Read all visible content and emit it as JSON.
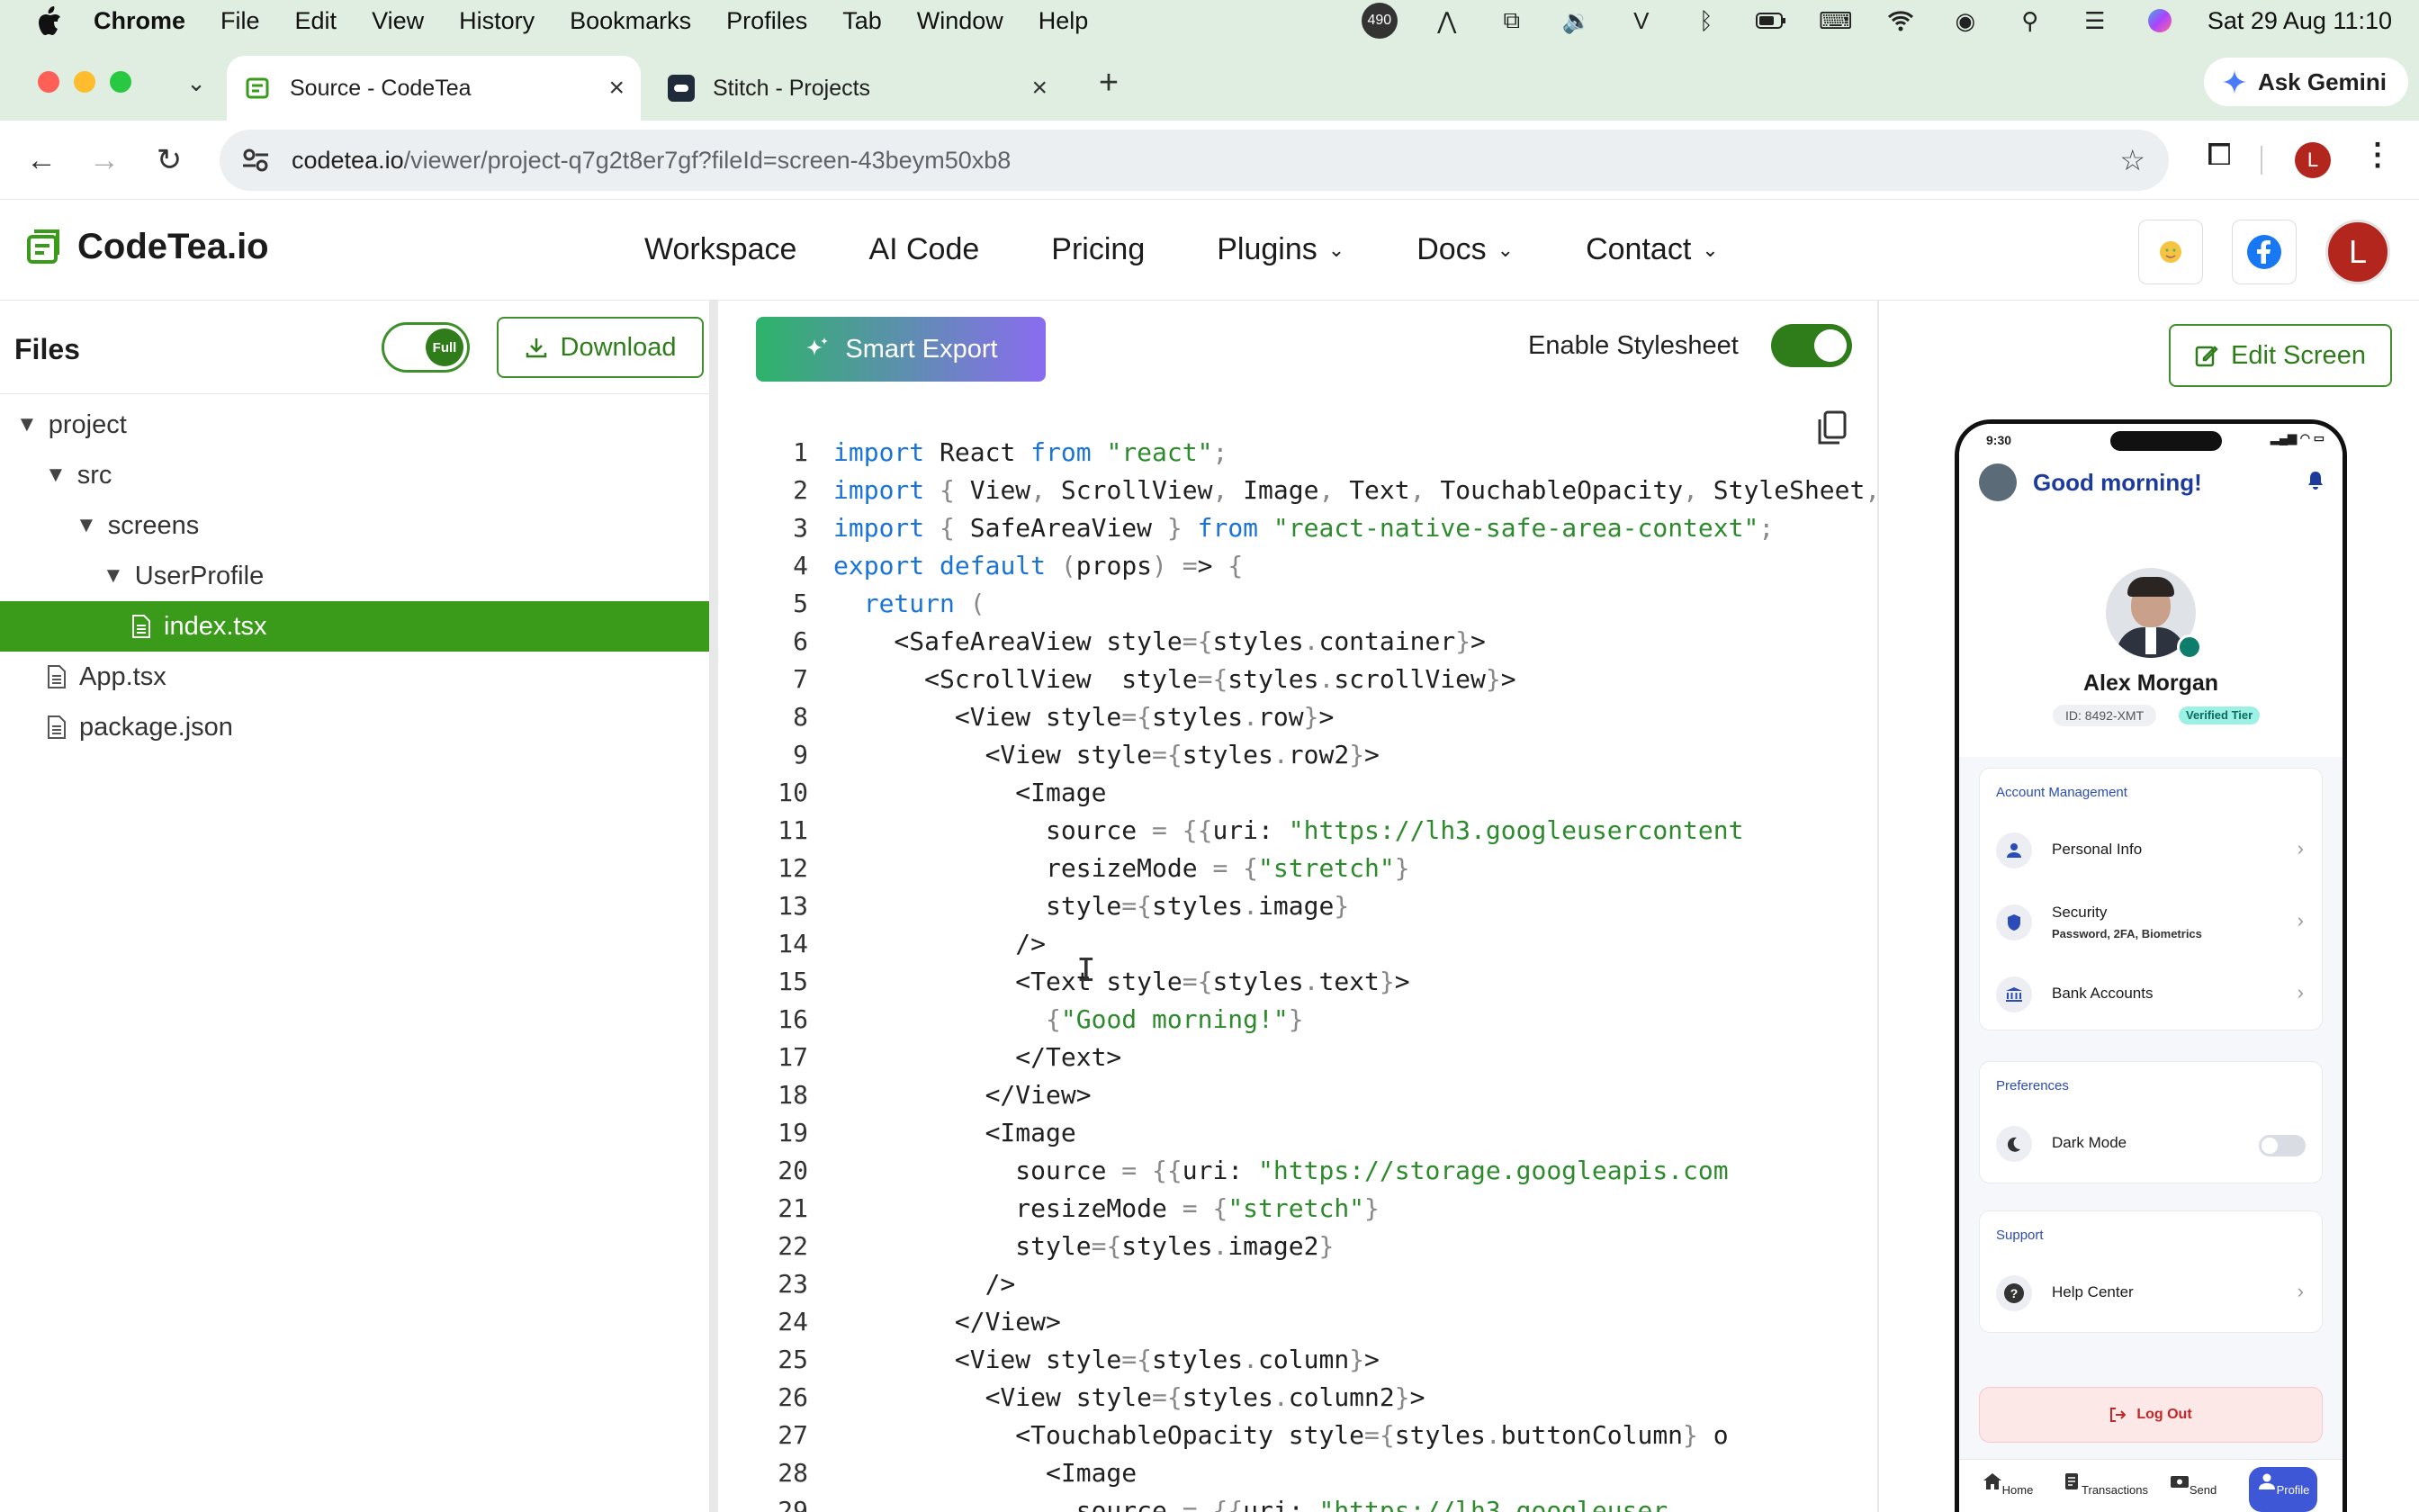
{
  "menubar": {
    "app": "Chrome",
    "items": [
      "File",
      "Edit",
      "View",
      "History",
      "Bookmarks",
      "Profiles",
      "Tab",
      "Window",
      "Help"
    ],
    "badge": "490",
    "datetime": "Sat 29 Aug  11:10"
  },
  "browser": {
    "tabs": [
      {
        "title": "Source - CodeTea",
        "active": true
      },
      {
        "title": "Stitch - Projects",
        "active": false
      }
    ],
    "ask_gemini": "Ask Gemini",
    "url_host": "codetea.io",
    "url_path": "/viewer/project-q7g2t8er7gf?fileId=screen-43beym50xb8",
    "profile_initial": "L"
  },
  "site": {
    "brand": "CodeTea.io",
    "nav": [
      {
        "label": "Workspace",
        "dropdown": false
      },
      {
        "label": "AI Code",
        "dropdown": false
      },
      {
        "label": "Pricing",
        "dropdown": false
      },
      {
        "label": "Plugins",
        "dropdown": true
      },
      {
        "label": "Docs",
        "dropdown": true
      },
      {
        "label": "Contact",
        "dropdown": true
      }
    ],
    "avatar_initial": "L"
  },
  "files": {
    "title": "Files",
    "toggle_label": "Full",
    "download": "Download",
    "tree": [
      {
        "name": "project",
        "type": "folder",
        "depth": 0,
        "selected": false
      },
      {
        "name": "src",
        "type": "folder",
        "depth": 1,
        "selected": false
      },
      {
        "name": "screens",
        "type": "folder",
        "depth": 2,
        "selected": false
      },
      {
        "name": "UserProfile",
        "type": "folder",
        "depth": 3,
        "selected": false
      },
      {
        "name": "index.tsx",
        "type": "file",
        "depth": 4,
        "selected": true
      },
      {
        "name": "App.tsx",
        "type": "file",
        "depth": 1,
        "selected": false
      },
      {
        "name": "package.json",
        "type": "file",
        "depth": 1,
        "selected": false
      }
    ]
  },
  "editor": {
    "smart_export": "Smart Export",
    "stylesheet_label": "Enable Stylesheet",
    "stylesheet_enabled": true,
    "lines": [
      "import React from \"react\";",
      "import { View, ScrollView, Image, Text, TouchableOpacity, StyleSheet, }",
      "import { SafeAreaView } from \"react-native-safe-area-context\";",
      "export default (props) => {",
      "  return (",
      "    <SafeAreaView style={styles.container}>",
      "      <ScrollView  style={styles.scrollView}>",
      "        <View style={styles.row}>",
      "          <View style={styles.row2}>",
      "            <Image",
      "              source = {{uri: \"https://lh3.googleusercontent",
      "              resizeMode = {\"stretch\"}",
      "              style={styles.image}",
      "            />",
      "            <Text style={styles.text}>",
      "              {\"Good morning!\"}",
      "            </Text>",
      "          </View>",
      "          <Image",
      "            source = {{uri: \"https://storage.googleapis.com",
      "            resizeMode = {\"stretch\"}",
      "            style={styles.image2}",
      "          />",
      "        </View>",
      "        <View style={styles.column}>",
      "          <View style={styles.column2}>",
      "            <TouchableOpacity style={styles.buttonColumn} o",
      "              <Image",
      "                source = {{uri: \"https://lh3.googleuser"
    ]
  },
  "preview": {
    "edit_screen": "Edit Screen",
    "phone": {
      "time": "9:30",
      "greeting": "Good morning!",
      "name": "Alex Morgan",
      "id": "ID: 8492-XMT",
      "tier": "Verified Tier",
      "sections": [
        {
          "title": "Account Management",
          "items": [
            {
              "label": "Personal Info",
              "sub": ""
            },
            {
              "label": "Security",
              "sub": "Password, 2FA, Biometrics"
            },
            {
              "label": "Bank Accounts",
              "sub": ""
            }
          ]
        },
        {
          "title": "Preferences",
          "items": [
            {
              "label": "Dark Mode",
              "sub": ""
            }
          ]
        },
        {
          "title": "Support",
          "items": [
            {
              "label": "Help Center",
              "sub": ""
            }
          ]
        }
      ],
      "logout": "Log Out",
      "tabs": [
        "Home",
        "Transactions",
        "Send",
        "Profile"
      ]
    }
  },
  "colors": {
    "accent_green": "#2f7d1a",
    "selected_row": "#3a9a1a",
    "keyword": "#1a73d9",
    "string": "#2d8a2d"
  }
}
